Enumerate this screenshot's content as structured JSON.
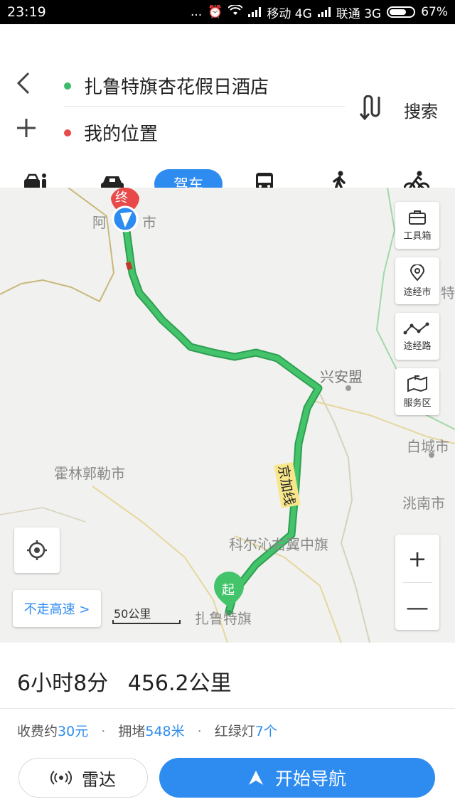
{
  "status_bar": {
    "time": "23:19",
    "dots": "...",
    "carrier1": "移动 4G",
    "carrier2": "联通 3G",
    "battery": "67%"
  },
  "header": {
    "destination": "扎鲁特旗杏花假日酒店",
    "origin": "我的位置",
    "search_label": "搜索",
    "dest_dot_color": "#3dbb6c",
    "origin_dot_color": "#e84a4a"
  },
  "modes": {
    "items": [
      "taxi-icon",
      "car-icon",
      "驾车",
      "bus-icon",
      "walk-icon",
      "bike-icon"
    ],
    "active_label": "驾车"
  },
  "map": {
    "labels": {
      "city_top": "阿",
      "city_top_b": "市",
      "xinganmeng": "兴安盟",
      "huolingole": "霍林郭勒市",
      "baicheng": "白城市",
      "taonan": "洮南市",
      "keyouzhong": "科尔沁右翼中旗",
      "zalute": "扎鲁特旗",
      "te": "特",
      "road": "京加线"
    },
    "end_marker": "终",
    "start_marker": "起",
    "tools": {
      "toolbox": "工具箱",
      "via_city": "途经市",
      "via_road": "途经路",
      "service": "服务区"
    },
    "zoom_in": "+",
    "zoom_out": "—",
    "no_highway": "不走高速 >",
    "scale": "50公里",
    "route_color": "#43c46a"
  },
  "route": {
    "duration": "6小时8分",
    "distance": "456.2公里",
    "toll_prefix": "收费约",
    "toll_value": "30元",
    "jam_prefix": "拥堵",
    "jam_value": "548米",
    "lights_prefix": "红绿灯",
    "lights_value": "7个",
    "bullet": "·",
    "radar_label": "雷达",
    "start_label": "开始导航"
  }
}
